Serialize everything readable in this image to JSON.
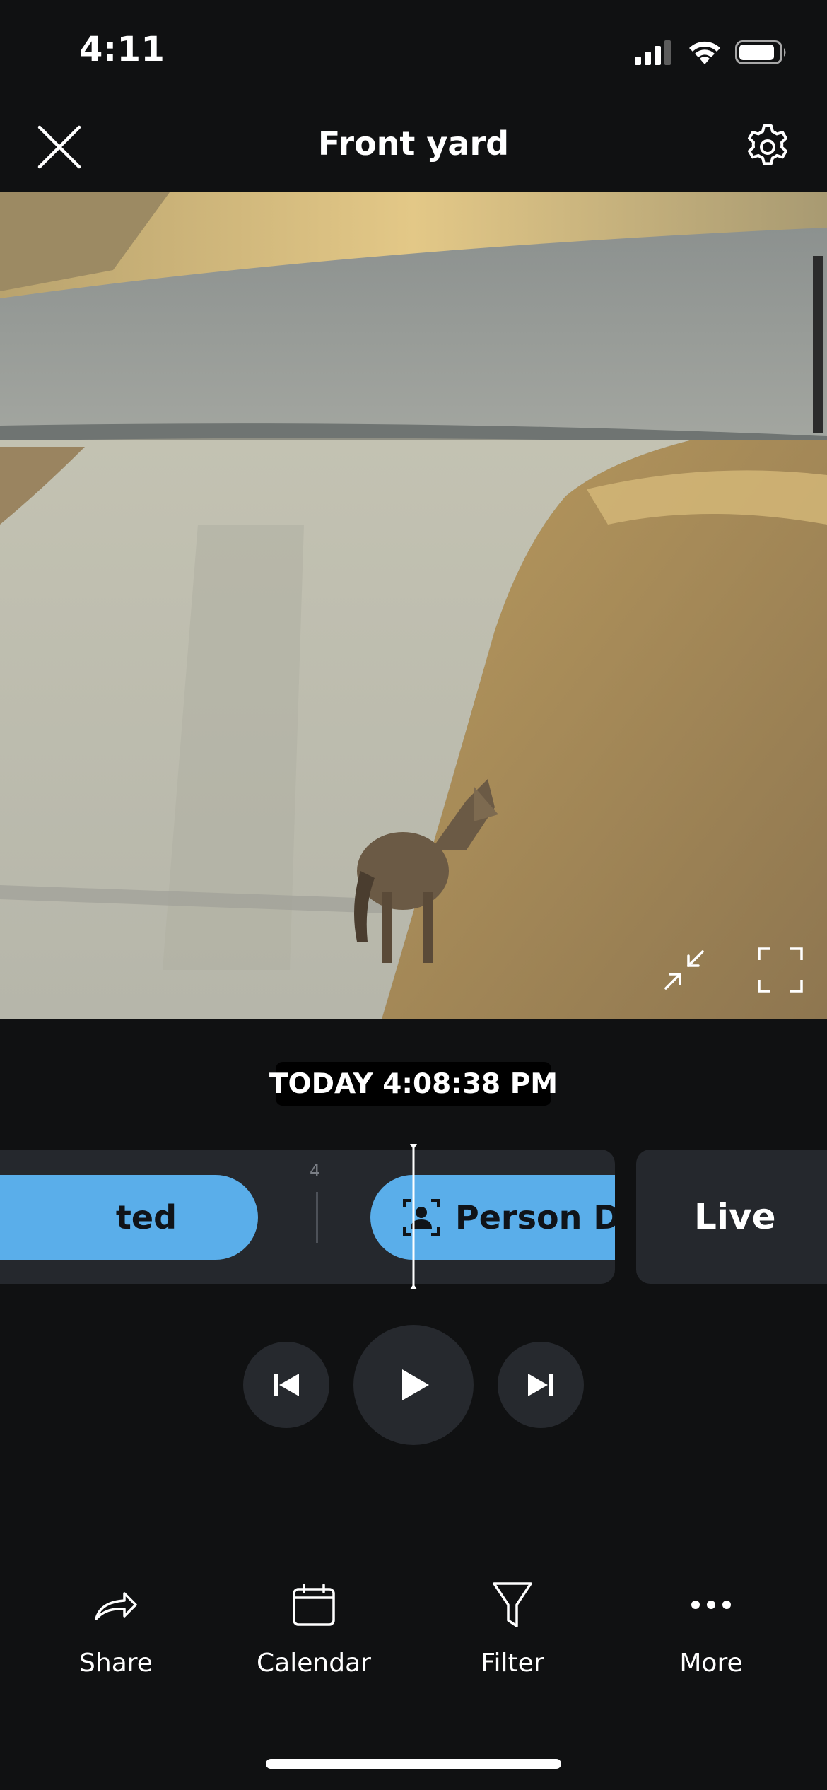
{
  "status_bar": {
    "time": "4:11"
  },
  "header": {
    "title": "Front yard",
    "close_icon": "close-icon",
    "settings_icon": "gear-icon"
  },
  "video": {
    "collapse_icon": "collapse-icon",
    "fullscreen_icon": "fullscreen-icon"
  },
  "timestamp": "TODAY 4:08:38 PM",
  "timeline": {
    "tick_label": "4",
    "events": [
      {
        "label": "ted",
        "color": "#5aaeea"
      },
      {
        "label": "Person De",
        "icon": "person-detected-icon",
        "color": "#5aaeea"
      }
    ],
    "live_label": "Live"
  },
  "playback": {
    "prev_icon": "skip-previous-icon",
    "play_icon": "play-icon",
    "next_icon": "skip-next-icon"
  },
  "toolbar": {
    "share": "Share",
    "calendar": "Calendar",
    "filter": "Filter",
    "more": "More"
  },
  "colors": {
    "background": "#101112",
    "panel": "#25282d",
    "event": "#5aaeea"
  }
}
